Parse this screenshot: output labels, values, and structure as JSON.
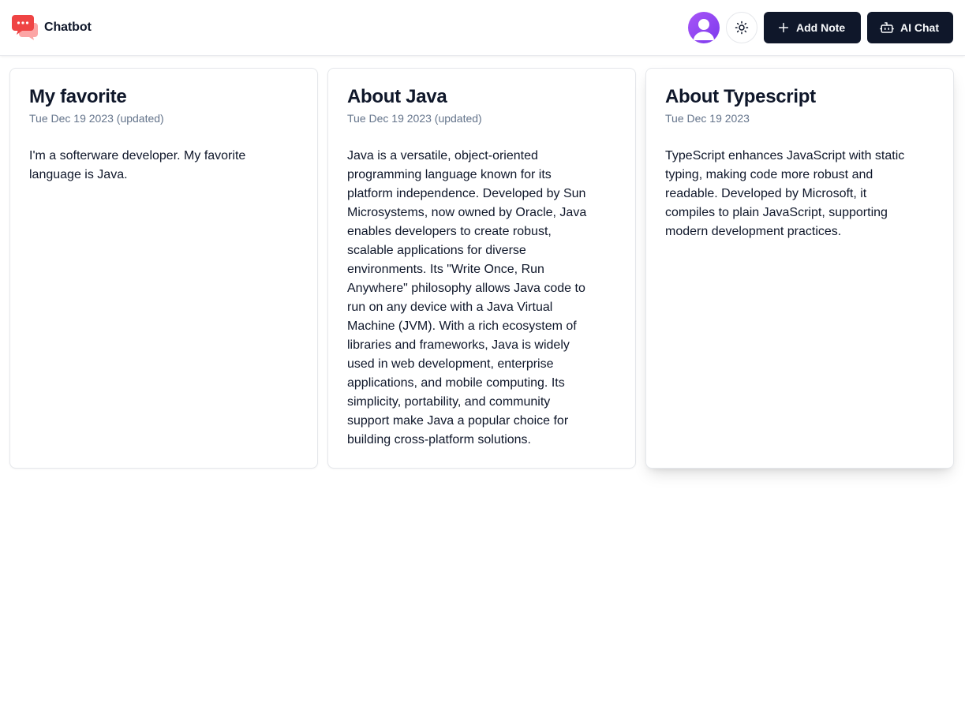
{
  "navbar": {
    "brand_name": "Chatbot",
    "logo_icon": "chat-bubbles-icon",
    "avatar_icon": "user-icon",
    "theme_icon": "sun-icon",
    "add_note_label": "Add Note",
    "add_note_icon": "plus-icon",
    "ai_chat_label": "AI Chat",
    "ai_chat_icon": "bot-icon"
  },
  "colors": {
    "primary": "#0f172a",
    "logo": "#ef4444",
    "avatar": "#a855f7",
    "muted_text": "#64748b"
  },
  "notes": [
    {
      "title": "My favorite",
      "date": "Tue Dec 19 2023 (updated)",
      "content": "I'm a softerware developer. My favorite\nlanguage is Java."
    },
    {
      "title": "About Java",
      "date": "Tue Dec 19 2023 (updated)",
      "content": "Java is a versatile, object-oriented\nprogramming language known for its\nplatform independence. Developed by Sun\nMicrosystems, now owned by Oracle, Java\nenables developers to create robust,\nscalable applications for diverse\nenvironments. Its \"Write Once, Run\nAnywhere\" philosophy allows Java code to\nrun on any device with a Java Virtual\nMachine (JVM). With a rich ecosystem of\nlibraries and frameworks, Java is widely\nused in web development, enterprise\napplications, and mobile computing. Its\nsimplicity, portability, and community\nsupport make Java a popular choice for\nbuilding cross-platform solutions."
    },
    {
      "title": "About Typescript",
      "date": "Tue Dec 19 2023",
      "content": "TypeScript enhances JavaScript with static\ntyping, making code more robust and\nreadable. Developed by Microsoft, it\ncompiles to plain JavaScript, supporting\nmodern development practices."
    }
  ]
}
